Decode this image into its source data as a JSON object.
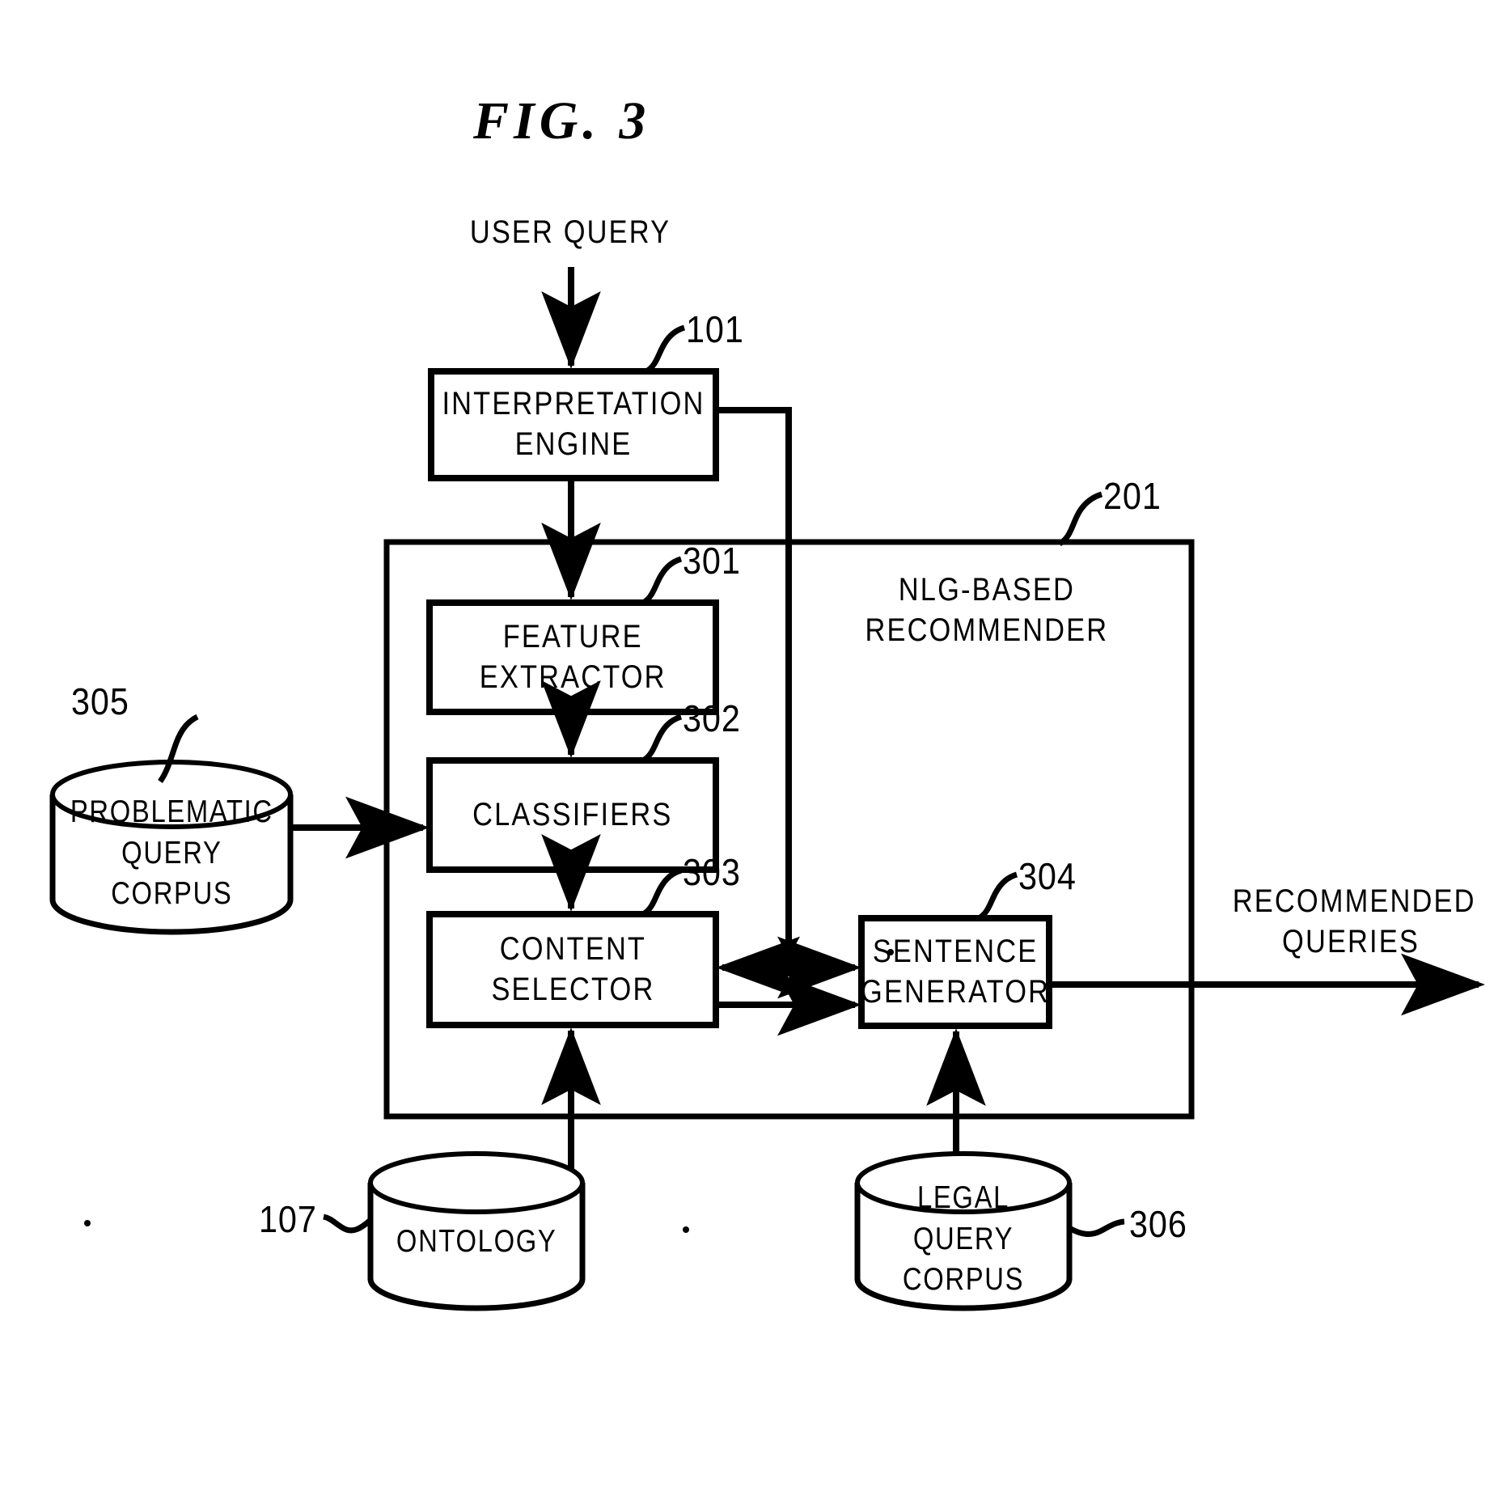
{
  "figure": {
    "title": "FIG.  3",
    "flow_labels": {
      "input": "USER QUERY",
      "output_line1": "RECOMMENDED",
      "output_line2": "QUERIES"
    },
    "boxes": [
      {
        "id": "interpretation-engine",
        "ref": "101",
        "line1": "INTERPRETATION",
        "line2": "ENGINE"
      },
      {
        "id": "feature-extractor",
        "ref": "301",
        "line1": "FEATURE",
        "line2": "EXTRACTOR"
      },
      {
        "id": "classifiers",
        "ref": "302",
        "line1": "CLASSIFIERS",
        "line2": ""
      },
      {
        "id": "content-selector",
        "ref": "303",
        "line1": "CONTENT",
        "line2": "SELECTOR"
      },
      {
        "id": "sentence-generator",
        "ref": "304",
        "line1": "SENTENCE",
        "line2": "GENERATOR"
      }
    ],
    "container": {
      "id": "nlg-based-recommender",
      "ref": "201",
      "line1": "NLG-BASED",
      "line2": "RECOMMENDER"
    },
    "datastores": [
      {
        "id": "problematic-query-corpus",
        "ref": "305",
        "line1": "PROBLEMATIC",
        "line2": "QUERY CORPUS"
      },
      {
        "id": "ontology",
        "ref": "107",
        "line1": "ONTOLOGY",
        "line2": ""
      },
      {
        "id": "legal-query-corpus",
        "ref": "306",
        "line1": "LEGAL QUERY",
        "line2": "CORPUS"
      }
    ],
    "colors": {
      "ink": "#000000",
      "paper": "#ffffff"
    }
  }
}
